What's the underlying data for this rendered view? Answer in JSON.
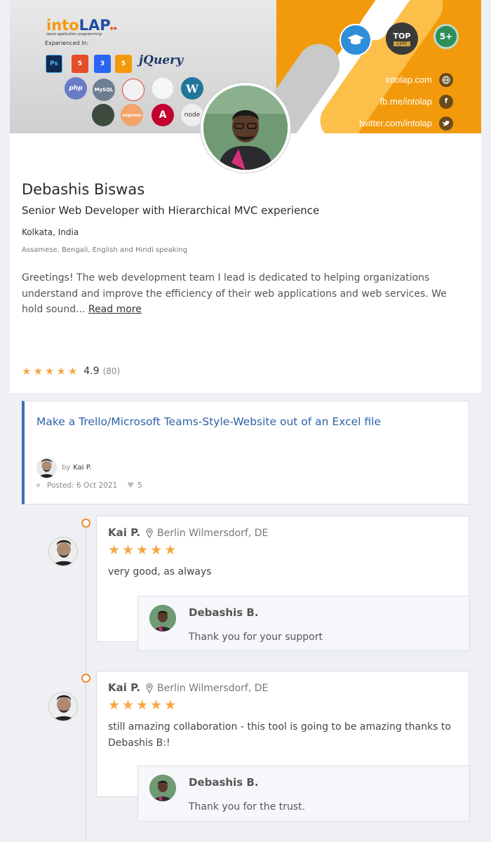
{
  "banner": {
    "logo_part1": "into",
    "logo_part2": "LAP",
    "logo_arrow": "▸▸",
    "logo_tagline": "latest application programming",
    "experienced_label": "Experienced In:",
    "tech": {
      "ps": "Ps",
      "html5": "5",
      "css3": "3",
      "html5b": "5",
      "jquery": "jQuery",
      "php": "php",
      "mysql": "MySQL",
      "laravel": "",
      "codeigniter": "",
      "wordpress": "W",
      "mongodb": "",
      "express": "express",
      "angular": "A",
      "node": "node"
    },
    "badges": {
      "top": "TOP",
      "cert": "CERT",
      "five_plus": "5+"
    },
    "links": [
      {
        "text": "intolap.com",
        "icon": "globe-icon"
      },
      {
        "text": "fb.me/intolap",
        "icon": "facebook-icon"
      },
      {
        "text": "twitter.com/intolap",
        "icon": "twitter-icon"
      }
    ]
  },
  "profile": {
    "name": "Debashis Biswas",
    "headline": "Senior Web Developer with Hierarchical MVC experience",
    "location": "Kolkata, India",
    "languages": "Assamese, Bengali, English and Hindi speaking",
    "bio": "Greetings! The web development team I lead is dedicated to helping organizations understand and improve the efficiency of their web applications and web services. We hold sound... ",
    "read_more": "Read more",
    "rating": "4.9",
    "rating_count": "(80)",
    "stars": 5
  },
  "project": {
    "title": "Make a Trello/Microsoft Teams-Style-Website out of an Excel file",
    "by_label": "by",
    "by_name": "Kai P.",
    "posted": "Posted: 6 Oct 2021",
    "likes": "5"
  },
  "reviews": [
    {
      "name": "Kai P.",
      "location": "Berlin Wilmersdorf, DE",
      "stars": 5,
      "text": "very good, as always",
      "reply_name": "Debashis B.",
      "reply_text": "Thank you for your support"
    },
    {
      "name": "Kai P.",
      "location": "Berlin Wilmersdorf, DE",
      "stars": 5,
      "text": "still amazing collaboration - this tool is going to be amazing thanks to Debashis B:!",
      "reply_name": "Debashis B.",
      "reply_text": "Thank you for the trust."
    }
  ],
  "colors": {
    "accent": "#f29a0c",
    "link_blue": "#2f62a8",
    "star": "#f5a742",
    "timeline_dot": "#f08a2a"
  }
}
